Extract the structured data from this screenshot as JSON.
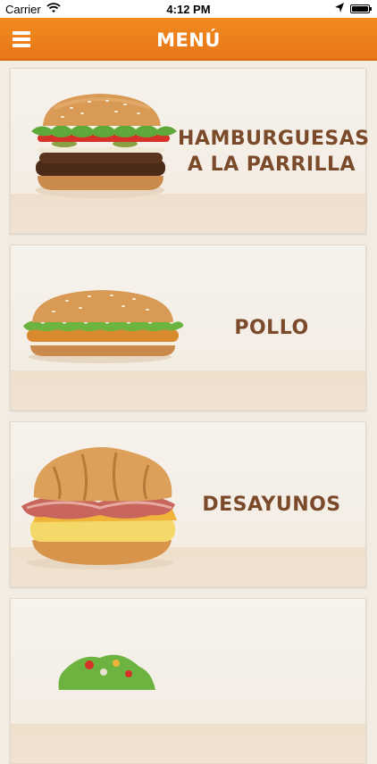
{
  "status_bar": {
    "carrier": "Carrier",
    "time": "4:12 PM"
  },
  "header": {
    "title": "MENÚ",
    "menu_icon": "hamburger-menu-icon"
  },
  "categories": [
    {
      "label_line1": "HAMBURGUESAS",
      "label_line2": "A LA PARRILLA",
      "image": "grilled-burger"
    },
    {
      "label_line1": "POLLO",
      "label_line2": "",
      "image": "chicken-sandwich"
    },
    {
      "label_line1": "DESAYUNOS",
      "label_line2": "",
      "image": "breakfast-croissant"
    },
    {
      "label_line1": "",
      "label_line2": "",
      "image": "salad"
    }
  ],
  "colors": {
    "accent": "#e8771a",
    "label_text": "#7a4a2a",
    "background": "#f2ece3"
  }
}
